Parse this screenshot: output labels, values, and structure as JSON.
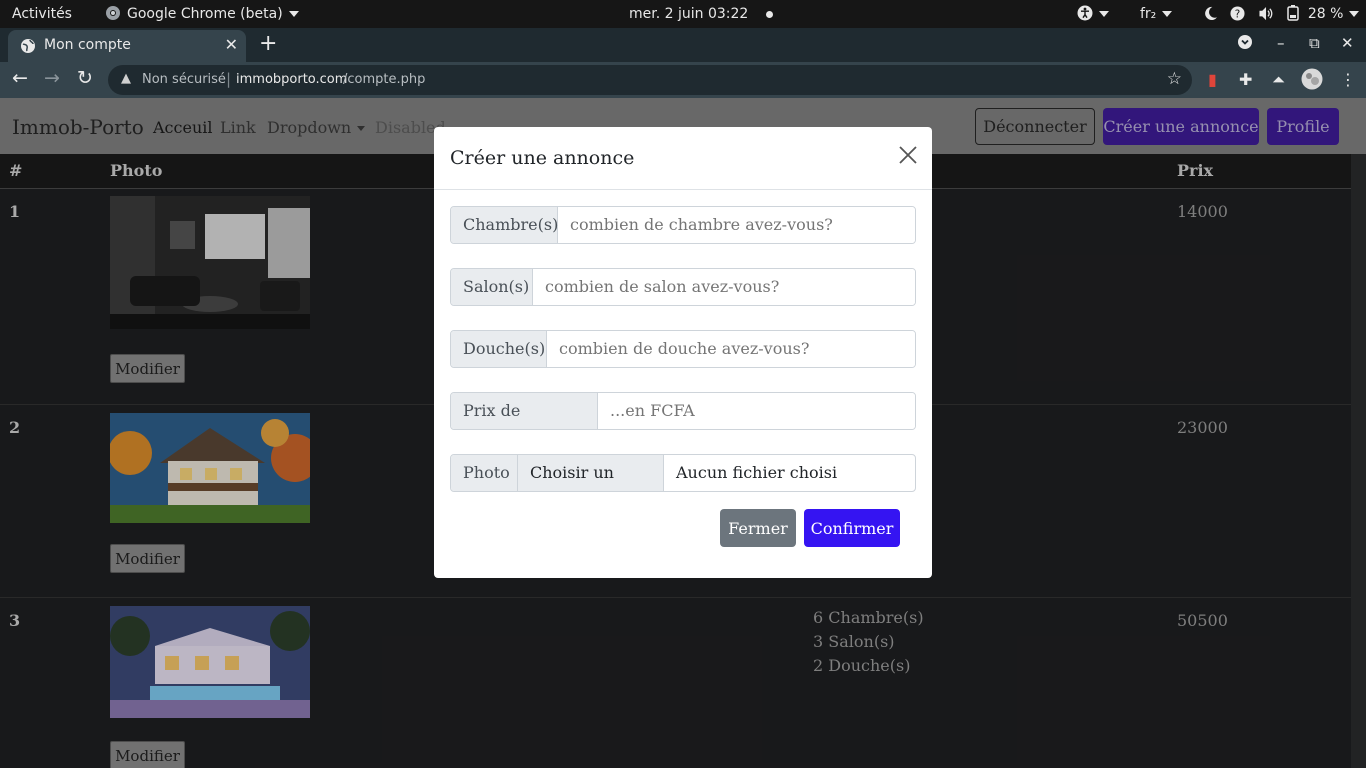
{
  "system_bar": {
    "activities": "Activités",
    "app_name": "Google Chrome (beta)",
    "datetime": "mer. 2 juin  03:22",
    "keyboard_layout": "fr₂",
    "battery": "28 %"
  },
  "browser": {
    "tab_title": "Mon compte",
    "security_label": "Non sécurisé",
    "url_host": "immobporto.com",
    "url_path": "/compte.php"
  },
  "navbar": {
    "brand": "Immob-Porto",
    "links": [
      "Acceuil",
      "Link",
      "Dropdown",
      "Disabled"
    ],
    "logout_label": "Déconnecter",
    "create_label": "Créer une annonce",
    "profile_label": "Profile"
  },
  "table": {
    "headers": {
      "num": "#",
      "photo": "Photo",
      "price": "Prix"
    },
    "rows": [
      {
        "num": "1",
        "price": "14000",
        "modify_label": "Modifier"
      },
      {
        "num": "2",
        "price": "23000",
        "modify_label": "Modifier"
      },
      {
        "num": "3",
        "price": "50500",
        "modify_label": "Modifier",
        "features": [
          "6 Chambre(s)",
          "3 Salon(s)",
          "2 Douche(s)"
        ]
      }
    ]
  },
  "modal": {
    "title": "Créer une annonce",
    "fields": [
      {
        "label": "Chambre(s)",
        "placeholder": "combien de chambre avez-vous?"
      },
      {
        "label": "Salon(s)",
        "placeholder": "combien de salon avez-vous?"
      },
      {
        "label": "Douche(s)",
        "placeholder": "combien de douche avez-vous?"
      },
      {
        "label": "Prix de location :",
        "placeholder": "...en FCFA"
      }
    ],
    "photo": {
      "label": "Photo",
      "button": "Choisir un fichier",
      "status": "Aucun fichier choisi"
    },
    "close_label": "Fermer",
    "confirm_label": "Confirmer"
  },
  "colors": {
    "primary": "#3514f2",
    "secondary": "#6c757d",
    "navbar": "#7f7f7f"
  }
}
